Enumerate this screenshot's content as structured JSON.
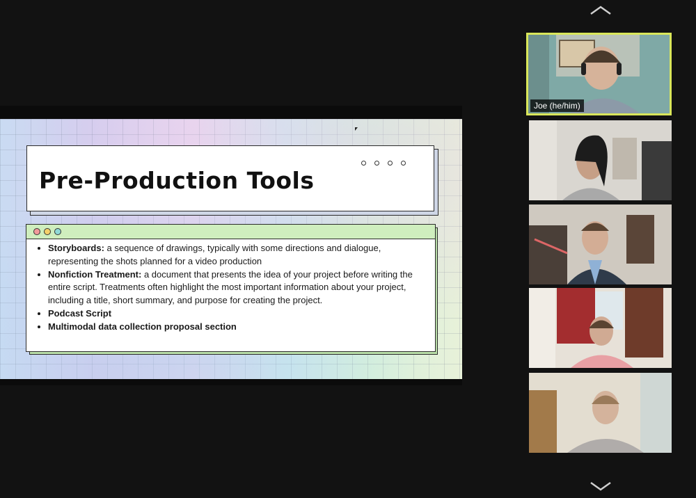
{
  "slide": {
    "title": "Pre-Production Tools",
    "bullets": [
      {
        "term": "Storyboards:",
        "text": " a sequence of drawings, typically with some directions and dialogue, representing the shots planned for a video production"
      },
      {
        "term": "Nonfiction Treatment:",
        "text": " a document that presents the idea of your project before writing the entire script. Treatments often highlight the most important information about your project, including a title, short summary, and purpose for creating the project."
      },
      {
        "term": "Podcast Script",
        "text": ""
      },
      {
        "term": "Multimodal data collection proposal section",
        "text": ""
      }
    ]
  },
  "gallery": {
    "scroll_up_icon": "chevron-up-icon",
    "scroll_down_icon": "chevron-down-icon",
    "active_speaker_color": "#d9e65a",
    "participants": [
      {
        "name": "Joe (he/him)",
        "active": true
      },
      {
        "name": "",
        "active": false
      },
      {
        "name": "",
        "active": false
      },
      {
        "name": "",
        "active": false
      },
      {
        "name": "",
        "active": false
      }
    ]
  }
}
